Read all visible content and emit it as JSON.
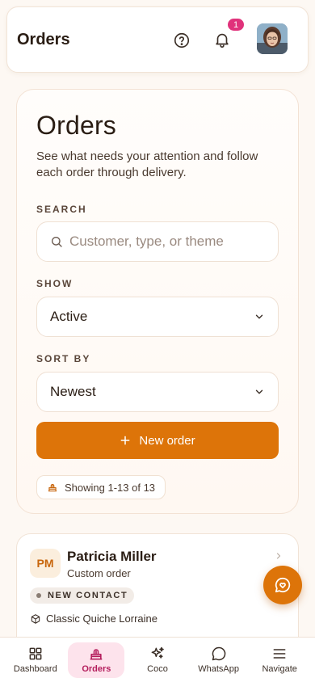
{
  "header": {
    "title": "Orders",
    "notification_count": "1",
    "help_icon": "help-circle-icon",
    "bell_icon": "bell-icon"
  },
  "main": {
    "title": "Orders",
    "subtitle": "See what needs your attention and follow each order through delivery.",
    "search": {
      "label": "SEARCH",
      "placeholder": "Customer, type, or theme"
    },
    "show": {
      "label": "SHOW",
      "value": "Active"
    },
    "sort": {
      "label": "SORT BY",
      "value": "Newest"
    },
    "new_order_label": "New order",
    "showing_text": "Showing 1-13 of 13"
  },
  "orders": [
    {
      "initials": "PM",
      "name": "Patricia Miller",
      "type": "Custom order",
      "tag": "NEW CONTACT",
      "item": "Classic Quiche Lorraine"
    }
  ],
  "nav": {
    "items": [
      {
        "label": "Dashboard",
        "icon": "grid-icon"
      },
      {
        "label": "Orders",
        "icon": "cake-icon",
        "active": true
      },
      {
        "label": "Coco",
        "icon": "sparkles-icon"
      },
      {
        "label": "WhatsApp",
        "icon": "chat-bubble-icon"
      },
      {
        "label": "Navigate",
        "icon": "menu-icon"
      }
    ]
  },
  "colors": {
    "accent": "#dd7409",
    "badge": "#e0327b",
    "nav_active_bg": "#fde3ec",
    "nav_active_text": "#b41d5c"
  }
}
